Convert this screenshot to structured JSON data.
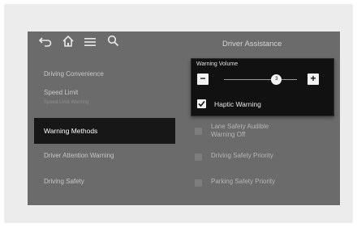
{
  "header": {
    "title": "Driver Assistance"
  },
  "icons": {
    "back": "back-icon",
    "home": "home-icon",
    "menu": "menu-icon",
    "search": "search-icon"
  },
  "sidebar": {
    "items": [
      {
        "label": "Driving Convenience",
        "sub": ""
      },
      {
        "label": "Speed Limit",
        "sub": "Speed Limit Warning"
      },
      {
        "label": "Warning Methods",
        "sub": ""
      },
      {
        "label": "Driver Attention Warning",
        "sub": ""
      },
      {
        "label": "Driving Safety",
        "sub": ""
      }
    ],
    "active_index": 2
  },
  "popup": {
    "title": "Warning Volume",
    "minus_label": "−",
    "plus_label": "+",
    "volume_value": "3",
    "volume_fraction": 0.72,
    "haptic_label": "Haptic Warning",
    "haptic_checked": true
  },
  "options": [
    {
      "line1": "Lane Safety Audible",
      "line2": "Warning Off"
    },
    {
      "line1": "Driving Safety Priority",
      "line2": ""
    },
    {
      "line1": "Parking Safety Priority",
      "line2": ""
    }
  ],
  "colors": {
    "screen_bg": "#6b6b6b",
    "active_bg": "#171717",
    "popup_bg": "#111111"
  }
}
